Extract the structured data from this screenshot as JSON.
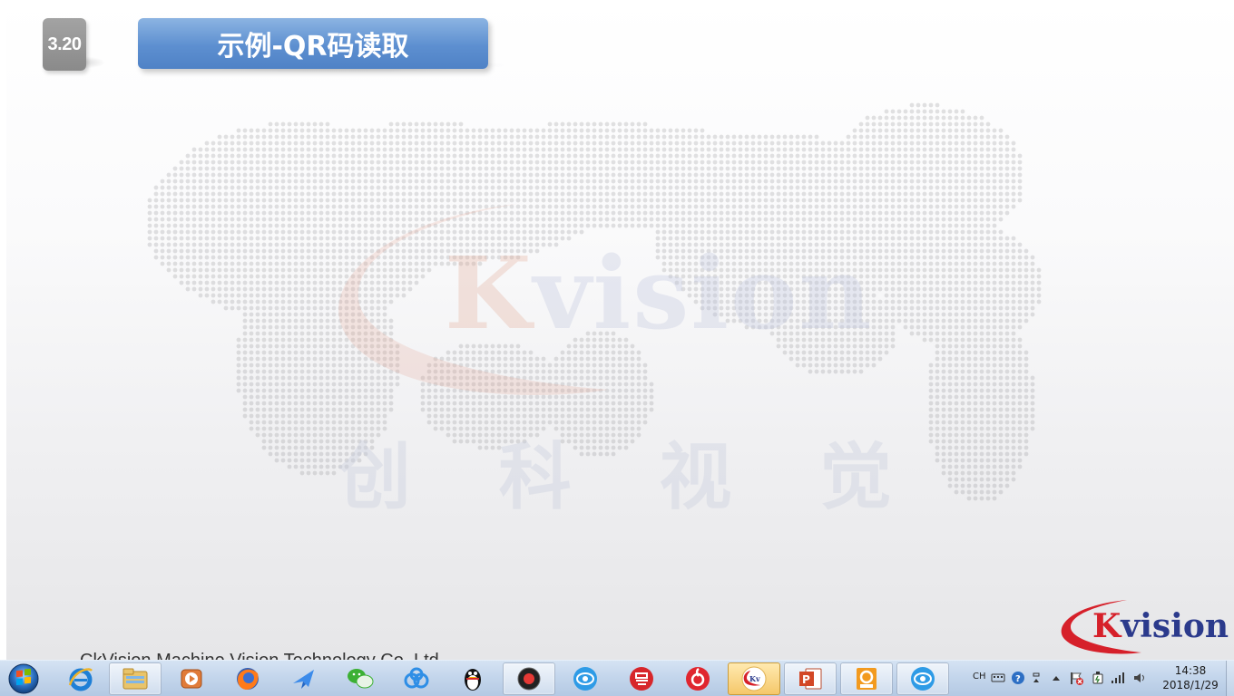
{
  "slide": {
    "section_number": "3.20",
    "title": "示例-QR码读取",
    "watermark_brand": "Kvision",
    "watermark_brand_k": "K",
    "watermark_brand_rest": "vision",
    "watermark_cn": [
      "创",
      "科",
      "视",
      "觉"
    ],
    "footer_copyright": "CkVision Machine Vision Technology Co.,Ltd",
    "corner_logo_k": "K",
    "corner_logo_rest": "vision",
    "colors": {
      "title_banner": "#5d8fd0",
      "badge": "#9a9a9a",
      "logo_blue": "#2b3a8c",
      "logo_red": "#d6202a"
    }
  },
  "taskbar": {
    "start_label": "Start",
    "items": [
      {
        "name": "internet-explorer",
        "icon": "ie-icon",
        "state": "pinned"
      },
      {
        "name": "windows-explorer",
        "icon": "folder-icon",
        "state": "running"
      },
      {
        "name": "media-player",
        "icon": "play-icon",
        "state": "pinned"
      },
      {
        "name": "firefox",
        "icon": "firefox-icon",
        "state": "pinned"
      },
      {
        "name": "feishu",
        "icon": "bird-icon",
        "state": "pinned"
      },
      {
        "name": "wechat",
        "icon": "wechat-icon",
        "state": "pinned"
      },
      {
        "name": "baidu-netdisk",
        "icon": "cloud-icon",
        "state": "pinned"
      },
      {
        "name": "qq",
        "icon": "penguin-icon",
        "state": "pinned"
      },
      {
        "name": "recorder",
        "icon": "record-icon",
        "state": "running"
      },
      {
        "name": "ckvision-app-1",
        "icon": "ck-eye-icon",
        "state": "pinned"
      },
      {
        "name": "netease-app",
        "icon": "yi-icon",
        "state": "pinned"
      },
      {
        "name": "netease-music",
        "icon": "music-icon",
        "state": "pinned"
      },
      {
        "name": "kvision-app",
        "icon": "kvision-icon",
        "state": "active"
      },
      {
        "name": "powerpoint",
        "icon": "powerpoint-icon",
        "state": "running"
      },
      {
        "name": "foxit-pdf",
        "icon": "pdf-icon",
        "state": "running"
      },
      {
        "name": "ckvision-app-2",
        "icon": "ck-eye-icon",
        "state": "running"
      }
    ],
    "tray": {
      "language": "CH",
      "time": "14:38",
      "date": "2018/1/29"
    }
  }
}
